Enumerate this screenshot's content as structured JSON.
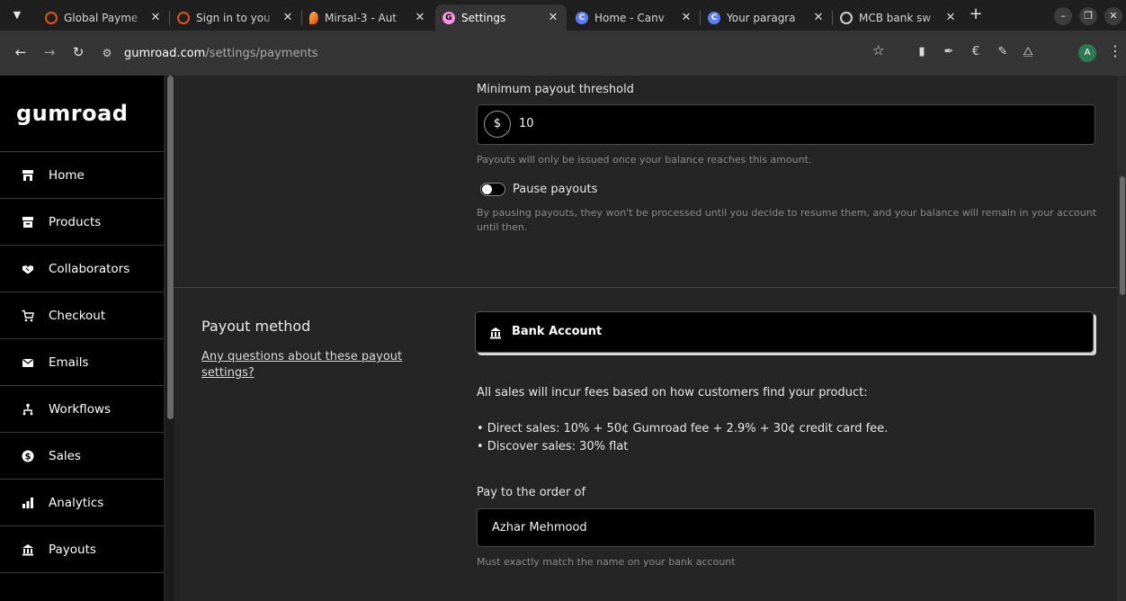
{
  "browser": {
    "tabs": [
      {
        "title": "Global Payme",
        "favicon": "ring-logo-icon",
        "fav_color": "#e0531f",
        "active": false
      },
      {
        "title": "Sign in to you",
        "favicon": "ring-logo-icon",
        "fav_color": "#e0531f",
        "active": false
      },
      {
        "title": "Mirsal-3 - Aut",
        "favicon": "flame-logo-icon",
        "fav_color": "#e7a42b",
        "active": false
      },
      {
        "title": "Settings",
        "favicon": "gumroad-favicon-icon",
        "fav_color": "#ff90e8",
        "active": true
      },
      {
        "title": "Home - Canv",
        "favicon": "canva-logo-icon",
        "fav_color": "#5b7dff",
        "active": false
      },
      {
        "title": "Your paragra",
        "favicon": "canva-logo-icon",
        "fav_color": "#5b7dff",
        "active": false
      },
      {
        "title": "MCB bank sw",
        "favicon": "openai-logo-icon",
        "fav_color": "#cfcfcf",
        "active": false
      }
    ],
    "new_tab_label": "+",
    "url_host": "gumroad.com",
    "url_path": "/settings/payments",
    "profile_initial": "A"
  },
  "sidebar": {
    "logo": "GUMroad",
    "items": [
      {
        "label": "Home",
        "icon": "storefront-icon"
      },
      {
        "label": "Products",
        "icon": "archive-box-icon"
      },
      {
        "label": "Collaborators",
        "icon": "handshake-icon"
      },
      {
        "label": "Checkout",
        "icon": "cart-icon"
      },
      {
        "label": "Emails",
        "icon": "envelope-icon"
      },
      {
        "label": "Workflows",
        "icon": "workflow-icon"
      },
      {
        "label": "Sales",
        "icon": "dollar-circle-icon"
      },
      {
        "label": "Analytics",
        "icon": "bar-chart-icon"
      },
      {
        "label": "Payouts",
        "icon": "bank-icon"
      }
    ]
  },
  "payouts": {
    "threshold_label": "Minimum payout threshold",
    "currency_symbol": "$",
    "threshold_value": "10",
    "threshold_hint": "Payouts will only be issued once your balance reaches this amount.",
    "pause_label": "Pause payouts",
    "pause_enabled": false,
    "pause_hint": "By pausing payouts, they won't be processed until you decide to resume them, and your balance will remain in your account until then.",
    "method_title": "Payout method",
    "help_link": "Any questions about these payout settings?",
    "method_option": "Bank Account",
    "fees_intro": "All sales will incur fees based on how customers find your product:",
    "fee_direct": "• Direct sales: 10% + 50¢ Gumroad fee + 2.9% + 30¢ credit card fee.",
    "fee_discover": "• Discover sales: 30% flat",
    "pay_to_label": "Pay to the order of",
    "pay_to_value": "Azhar Mehmood",
    "pay_to_hint": "Must exactly match the name on your bank account"
  }
}
